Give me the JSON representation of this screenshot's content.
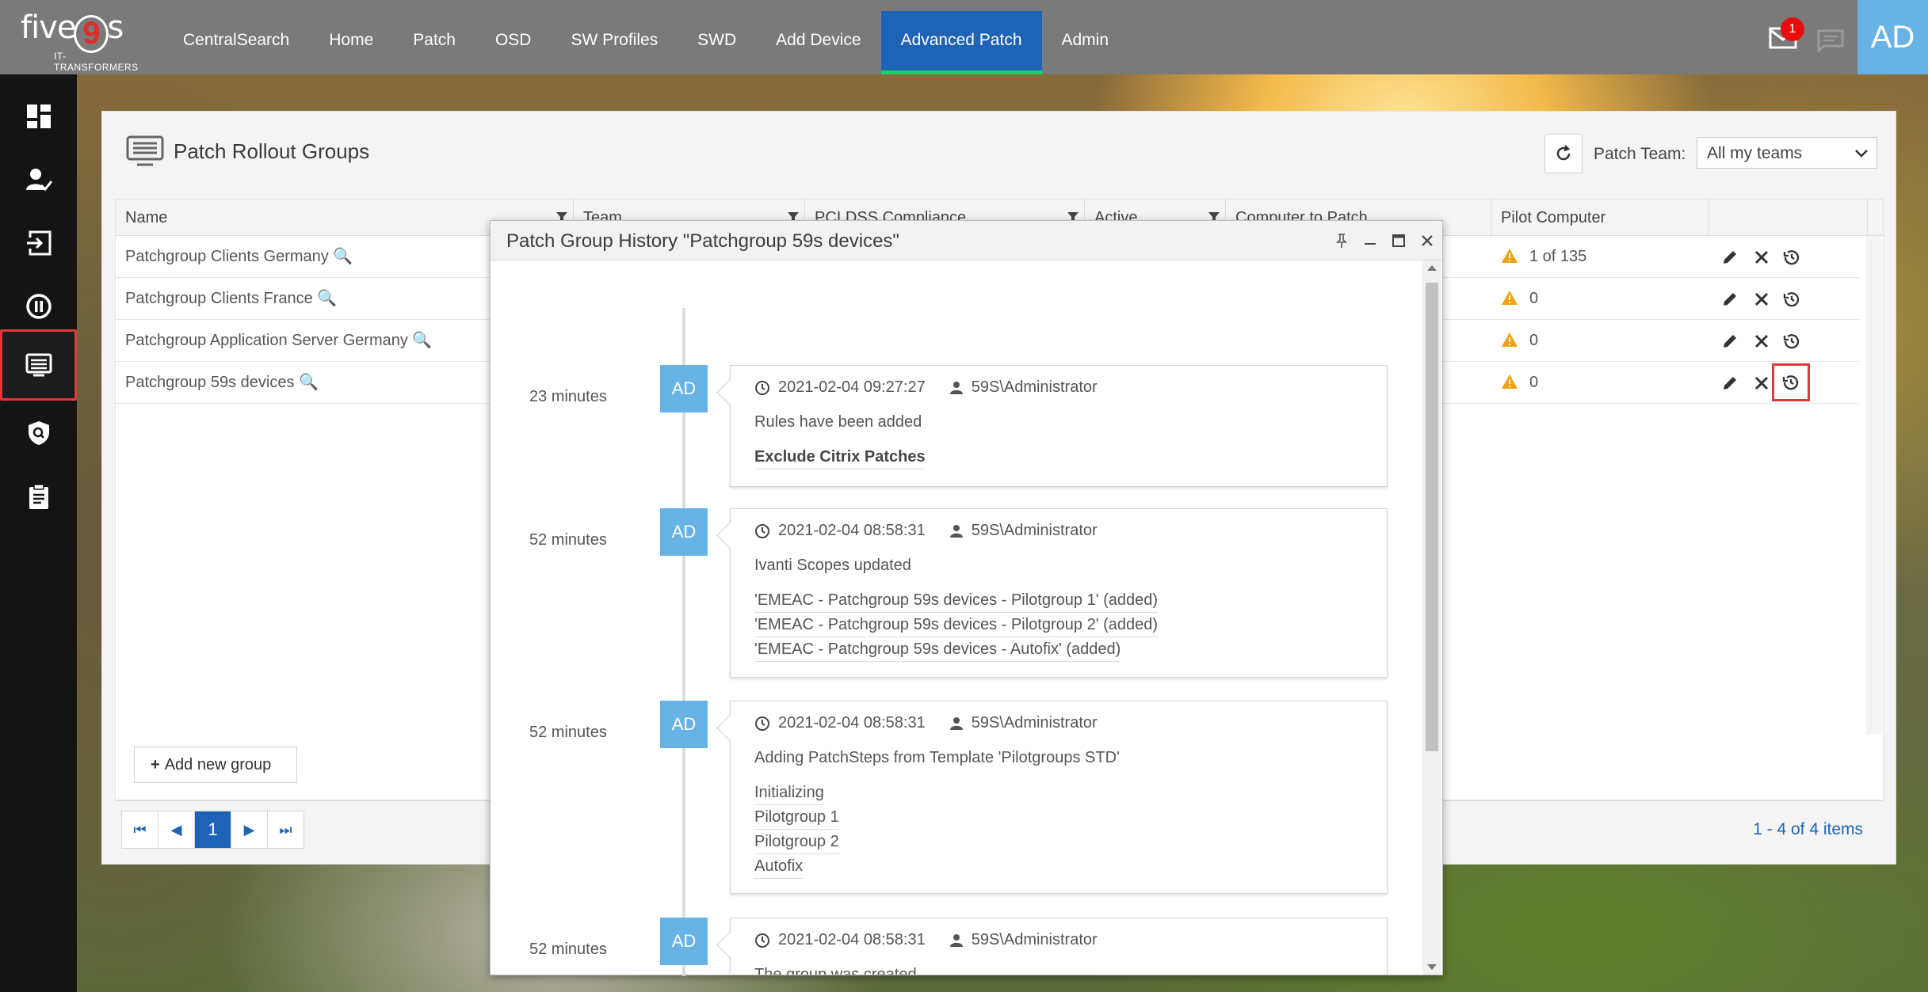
{
  "nav": {
    "items": [
      "CentralSearch",
      "Home",
      "Patch",
      "OSD",
      "SW Profiles",
      "SWD",
      "Add Device",
      "Advanced Patch",
      "Admin"
    ],
    "active": "Advanced Patch"
  },
  "logo": {
    "word_left": "five",
    "nine": "9",
    "word_right": "s",
    "tagline": "IT-TRANSFORMERS"
  },
  "header": {
    "mail_badge": "1",
    "avatar_initials": "AD"
  },
  "sidebar": {
    "items": [
      "dashboard-icon",
      "user-check-icon",
      "login-icon",
      "pause-circle-icon",
      "list-screen-icon",
      "shield-search-icon",
      "clipboard-icon"
    ],
    "active_index": 4
  },
  "panel": {
    "title": "Patch Rollout Groups",
    "team_label": "Patch Team:",
    "team_value": "All my teams"
  },
  "grid": {
    "columns": [
      "Name",
      "Team",
      "PCI DSS Compliance",
      "Active",
      "Computer to Patch",
      "Pilot Computer"
    ],
    "rows": [
      {
        "name": "Patchgroup Clients Germany",
        "pilot": "1 of 135"
      },
      {
        "name": "Patchgroup Clients France",
        "pilot": "0"
      },
      {
        "name": "Patchgroup Application Server Germany",
        "pilot": "0"
      },
      {
        "name": "Patchgroup 59s devices",
        "pilot": "0"
      }
    ],
    "add_button": "Add new group",
    "current_page": "1",
    "pager_info": "1 - 4 of 4 items"
  },
  "modal": {
    "title": "Patch Group History \"Patchgroup 59s devices\"",
    "entries": [
      {
        "ago": "23 minutes",
        "initials": "AD",
        "timestamp": "2021-02-04 09:27:27",
        "user": "59S\\Administrator",
        "message": "Rules have been added",
        "details": [
          "Exclude Citrix Patches"
        ]
      },
      {
        "ago": "52 minutes",
        "initials": "AD",
        "timestamp": "2021-02-04 08:58:31",
        "user": "59S\\Administrator",
        "message": "Ivanti Scopes updated",
        "details": [
          "'EMEAC - Patchgroup 59s devices - Pilotgroup 1' (added)",
          "'EMEAC - Patchgroup 59s devices - Pilotgroup 2' (added)",
          "'EMEAC - Patchgroup 59s devices - Autofix' (added)"
        ]
      },
      {
        "ago": "52 minutes",
        "initials": "AD",
        "timestamp": "2021-02-04 08:58:31",
        "user": "59S\\Administrator",
        "message": "Adding PatchSteps from Template 'Pilotgroups STD'",
        "details": [
          "Initializing",
          "Pilotgroup 1",
          "Pilotgroup 2",
          "Autofix"
        ]
      },
      {
        "ago": "52 minutes",
        "initials": "AD",
        "timestamp": "2021-02-04 08:58:31",
        "user": "59S\\Administrator",
        "message": "The group was created",
        "details": []
      }
    ]
  },
  "colors": {
    "brand_blue": "#1e63b5",
    "accent_light_blue": "#67b3e6",
    "active_underline": "#19d36b",
    "alert_red": "#e80d0d",
    "warning": "#f0a30a"
  }
}
